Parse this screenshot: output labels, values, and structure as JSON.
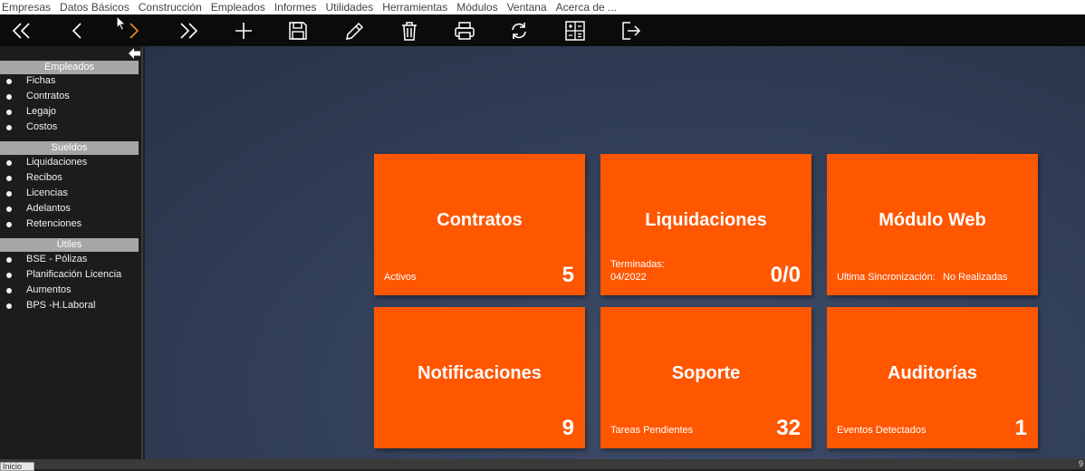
{
  "menu": {
    "items": [
      "Empresas",
      "Datos Básicos",
      "Construcción",
      "Empleados",
      "Informes",
      "Utilidades",
      "Herramientas",
      "Módulos",
      "Ventana",
      "Acerca de ..."
    ]
  },
  "toolbar": {
    "icons": [
      "first-icon",
      "previous-icon",
      "next-icon",
      "last-icon",
      "add-icon",
      "save-icon",
      "edit-icon",
      "delete-icon",
      "print-icon",
      "refresh-icon",
      "calculator-icon",
      "exit-icon"
    ],
    "colors": {
      "icon": "#ffffff",
      "active": "#f28c28"
    }
  },
  "sidebar": {
    "sections": [
      {
        "title": "Empleados",
        "items": [
          "Fichas",
          "Contratos",
          "Legajo",
          "Costos"
        ]
      },
      {
        "title": "Sueldos",
        "items": [
          "Liquidaciones",
          "Recibos",
          "Licencias",
          "Adelantos",
          "Retenciones"
        ]
      },
      {
        "title": "Útiles",
        "items": [
          "BSE - Pólizas",
          "Planificación Licencia",
          "Aumentos",
          "BPS -H.Laboral"
        ]
      }
    ]
  },
  "tiles": [
    {
      "title": "Contratos",
      "subtitle": "Activos",
      "count": "5"
    },
    {
      "title": "Liquidaciones",
      "subtitle_line1": "Terminadas:",
      "subtitle_line2": "04/2022",
      "count": "0/0"
    },
    {
      "title": "Módulo Web",
      "subtitle": "Ultima Sincronización:",
      "subtitle_value": "No Realizadas"
    },
    {
      "title": "Notificaciones",
      "count": "9"
    },
    {
      "title": "Soporte",
      "subtitle": "Tareas Pendientes",
      "count": "32"
    },
    {
      "title": "Auditorías",
      "subtitle": "Eventos Detectados",
      "count": "1"
    }
  ],
  "statusbar": {
    "tab_label": "Inicio",
    "corner": "9"
  },
  "colors": {
    "tile": "#ff5600",
    "section_header": "#a6a6a6",
    "background": "#33405a"
  }
}
